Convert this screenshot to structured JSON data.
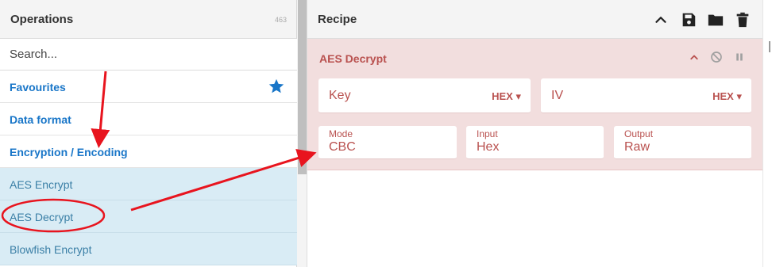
{
  "operations": {
    "title": "Operations",
    "count": "463",
    "search_placeholder": "Search...",
    "categories": [
      {
        "label": "Favourites"
      },
      {
        "label": "Data format"
      },
      {
        "label": "Encryption / Encoding"
      }
    ],
    "items": [
      {
        "label": "AES Encrypt"
      },
      {
        "label": "AES Decrypt"
      },
      {
        "label": "Blowfish Encrypt"
      }
    ],
    "favourite_icon": "star-icon"
  },
  "recipe": {
    "title": "Recipe",
    "header_icons": [
      "chevron-up-icon",
      "save-icon",
      "folder-icon",
      "trash-icon"
    ],
    "operation": {
      "name": "AES Decrypt",
      "icons": [
        "chevron-up-icon",
        "disable-icon",
        "pause-icon"
      ],
      "key": {
        "placeholder": "Key",
        "format": "HEX"
      },
      "iv": {
        "placeholder": "IV",
        "format": "HEX"
      },
      "mode": {
        "label": "Mode",
        "value": "CBC"
      },
      "input": {
        "label": "Input",
        "value": "Hex"
      },
      "output": {
        "label": "Output",
        "value": "Raw"
      }
    }
  },
  "colors": {
    "accent_blue": "#1976c8",
    "operation_text": "#3a7fa6",
    "operation_bg": "#d9ecf5",
    "card_bg": "#f2dede",
    "card_text": "#b9514f",
    "annotation_red": "#e8141e"
  }
}
